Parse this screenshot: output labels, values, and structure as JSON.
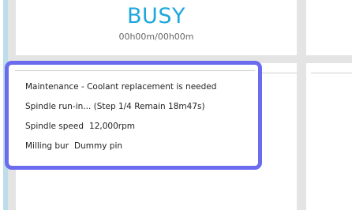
{
  "status": {
    "title": "BUSY",
    "time": "00h00m/00h00m"
  },
  "info": {
    "maintenance": "Maintenance - Coolant replacement is needed",
    "spindle_runin": "Spindle run-in... (Step 1/4 Remain 18m47s)",
    "spindle_speed_label": "Spindle speed",
    "spindle_speed_value": "12,000rpm",
    "milling_bur_label": "Milling bur",
    "milling_bur_value": "Dummy pin"
  },
  "colors": {
    "status_accent": "#1ea7dc",
    "highlight_border": "#6b6bef",
    "left_stripe": "#bcdde9"
  }
}
